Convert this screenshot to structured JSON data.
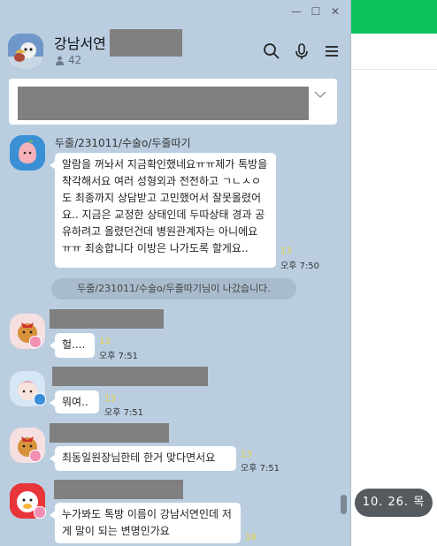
{
  "window": {
    "minimize": "—",
    "maximize": "☐",
    "close": "✕"
  },
  "header": {
    "title": "강남서연",
    "member_count": "42"
  },
  "date_pill": "10. 26. 목",
  "messages": [
    {
      "sender": "두줄/231011/수술o/두줄따기",
      "text": "알람을 꺼놔서 지금확인했네요ㅠㅠ제가 톡방을 착각해서요 여러 성형외과 전전하고 ㄱㄴㅅㅇ도 최종까지 상담받고 고민했어서 잘못올렸어요.. 지금은 교정한 상태인데 두따상태 경과 공유하려고 올렸던건데 병원관계자는 아니에요 ㅠㅠ 죄송합니다 이방은 나가도록 할게요..",
      "unread": "13",
      "time": "오후 7:50"
    },
    {
      "system": "두줄/231011/수술o/두줄따기님이 나갔습니다."
    },
    {
      "text": "헐....",
      "unread": "13",
      "time": "오후 7:51"
    },
    {
      "text": "뭐여..",
      "unread": "13",
      "time": "오후 7:51"
    },
    {
      "text": "최동일원장님한테 한거 맞다면서요",
      "unread": "13",
      "time": "오후 7:51"
    },
    {
      "text": "누가봐도 톡방 이름이 강남서연인데 저게 말이 되는 변명인가요",
      "unread": "18"
    }
  ]
}
